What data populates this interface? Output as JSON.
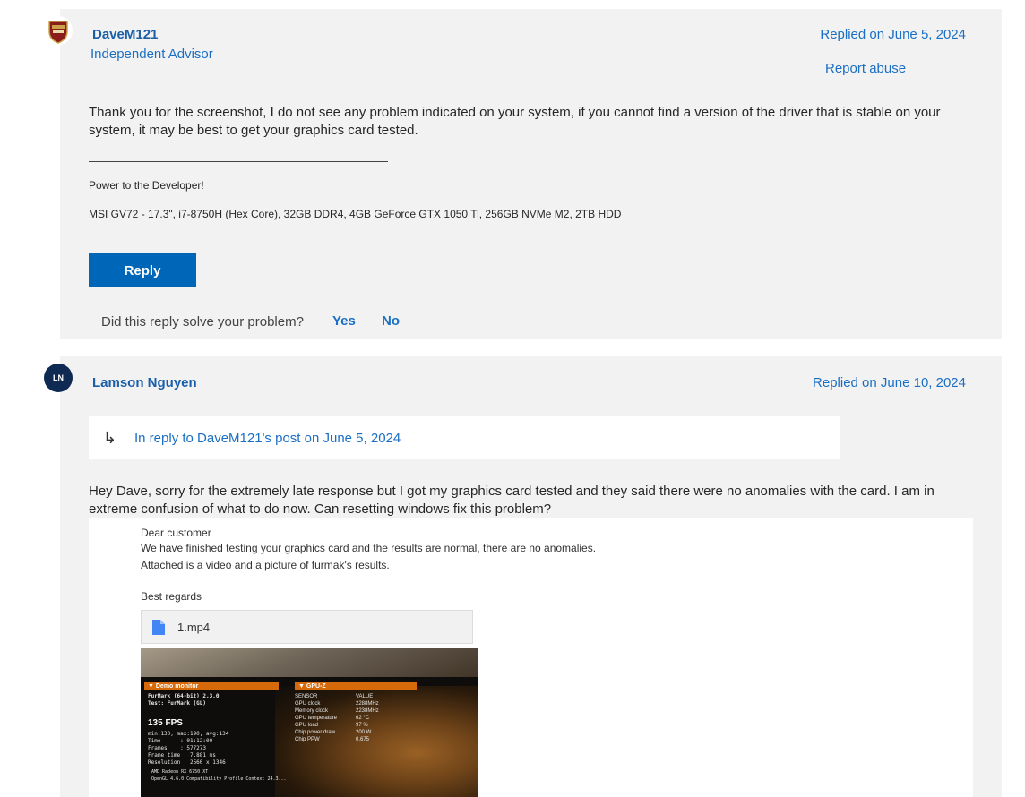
{
  "posts": [
    {
      "username": "DaveM121",
      "role": "Independent Advisor",
      "date": "Replied on June 5, 2024",
      "report": "Report abuse",
      "body": "Thank you for the screenshot, I do not see any problem indicated on your system, if you cannot find a version of the driver that is stable on your system, it may be best to get your graphics card tested.",
      "signature_line1": "Power to the Developer!",
      "signature_line2": "MSI GV72 - 17.3\", i7-8750H (Hex Core), 32GB DDR4, 4GB GeForce GTX 1050 Ti, 256GB NVMe M2, 2TB HDD",
      "reply_label": "Reply",
      "solve_question": "Did this reply solve your problem?",
      "yes_label": "Yes",
      "no_label": "No"
    },
    {
      "avatar_initials": "LN",
      "username": "Lamson Nguyen",
      "date": "Replied on June 10, 2024",
      "quote_arrow": "↳",
      "quote": "In reply to DaveM121's post on June 5, 2024",
      "body": "Hey Dave, sorry for the extremely late response but I got my graphics card tested and they said there were no anomalies with the card. I am in extreme confusion of what to do now. Can resetting windows fix this problem?",
      "image": {
        "line1": "Dear customer",
        "line2": "We have finished testing your graphics card and the results are normal, there are no anomalies.",
        "line3": "Attached is a video and a picture of furmak's results.",
        "line4": "Best regards",
        "attachment_name": "1.mp4",
        "furmark": {
          "panel_left": "▼ Demo monitor",
          "panel_right": "▼ GPU-Z",
          "info": "FurMark (64-bit) 2.3.0\nTest: FurMark (GL)",
          "fps": "135 FPS",
          "stats": "min:130, max:190, avg:134\nTime      : 01:12:00\nFrames    : 577273\nFrame time : 7.881 ms\nResolution : 2560 x 1346",
          "gpu_name": "AMD Radeon RX 6750 XT",
          "gl": "OpenGL 4.6.0 Compatibility Profile Context 24.3...",
          "sensors": [
            {
              "k": "SENSOR",
              "v": "VALUE"
            },
            {
              "k": "GPU clock",
              "v": "2288MHz"
            },
            {
              "k": "Memory clock",
              "v": "2238MHz"
            },
            {
              "k": "GPU temperature",
              "v": "62 °C"
            },
            {
              "k": "GPU load",
              "v": "97 %"
            },
            {
              "k": "Chip power draw",
              "v": "200 W"
            },
            {
              "k": "Chip PPW",
              "v": "0.675"
            }
          ]
        }
      }
    }
  ],
  "colors": {
    "link": "#1a6fc4",
    "button": "#0067b8",
    "card": "#f2f2f2",
    "avatar2": "#0e2a52"
  }
}
